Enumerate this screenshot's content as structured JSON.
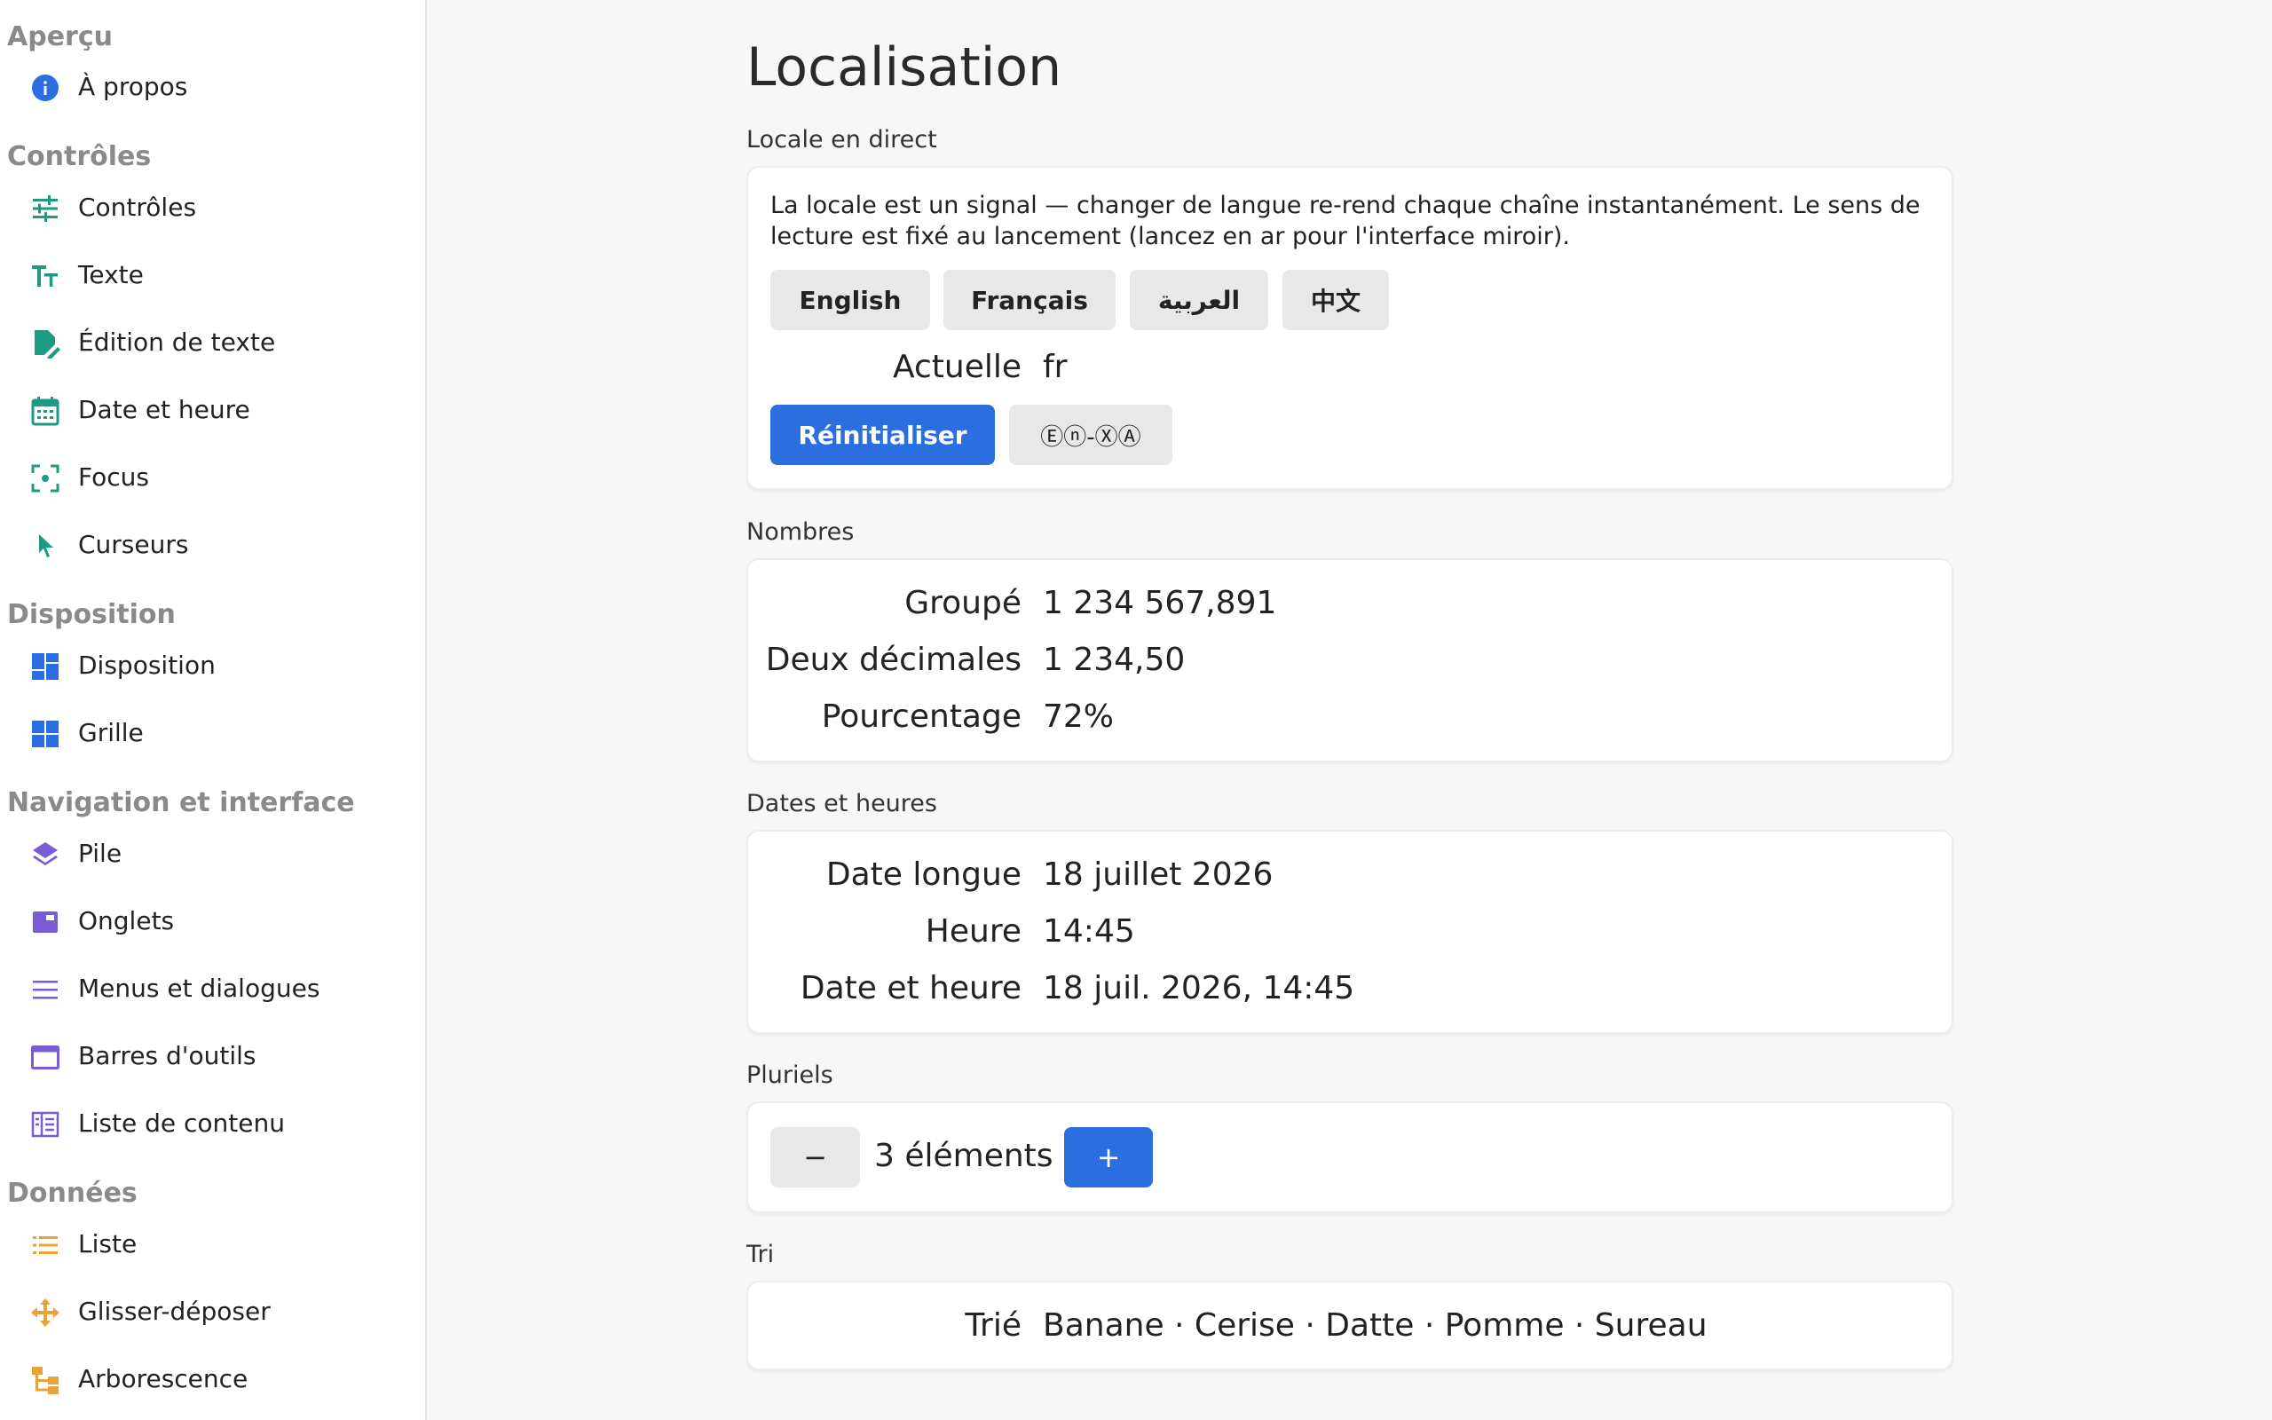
{
  "sidebar": {
    "sections": [
      {
        "title": "Aperçu",
        "items": [
          {
            "label": "À propos",
            "icon": "info-icon"
          }
        ]
      },
      {
        "title": "Contrôles",
        "items": [
          {
            "label": "Contrôles",
            "icon": "sliders-icon"
          },
          {
            "label": "Texte",
            "icon": "text-size-icon"
          },
          {
            "label": "Édition de texte",
            "icon": "edit-document-icon"
          },
          {
            "label": "Date et heure",
            "icon": "calendar-icon"
          },
          {
            "label": "Focus",
            "icon": "focus-icon"
          },
          {
            "label": "Curseurs",
            "icon": "pointer-icon"
          }
        ]
      },
      {
        "title": "Disposition",
        "items": [
          {
            "label": "Disposition",
            "icon": "dashboard-icon"
          },
          {
            "label": "Grille",
            "icon": "grid-icon"
          }
        ]
      },
      {
        "title": "Navigation et interface",
        "items": [
          {
            "label": "Pile",
            "icon": "layers-icon"
          },
          {
            "label": "Onglets",
            "icon": "tabs-icon"
          },
          {
            "label": "Menus et dialogues",
            "icon": "menu-icon"
          },
          {
            "label": "Barres d'outils",
            "icon": "toolbar-icon"
          },
          {
            "label": "Liste de contenu",
            "icon": "content-list-icon"
          }
        ]
      },
      {
        "title": "Données",
        "items": [
          {
            "label": "Liste",
            "icon": "list-icon"
          },
          {
            "label": "Glisser-déposer",
            "icon": "drag-move-icon"
          },
          {
            "label": "Arborescence",
            "icon": "tree-icon"
          }
        ]
      }
    ]
  },
  "colors": {
    "accent_blue": "#2a6ee0",
    "teal_icon": "#1f9a82",
    "blue_icon": "#2a6ee0",
    "purple_icon": "#7a5bd6",
    "orange_icon": "#e8a23a",
    "section_grey": "#8a8a8a"
  },
  "main": {
    "title": "Localisation",
    "live_locale": {
      "label": "Locale en direct",
      "description": "La locale est un signal — changer de langue re-rend chaque chaîne instantanément. Le sens de lecture est fixé au lancement (lancez en ar pour l'interface miroir).",
      "language_buttons": [
        "English",
        "Français",
        "العربية",
        "中文"
      ],
      "current_label": "Actuelle",
      "current_value": "fr",
      "reset_label": "Réinitialiser",
      "pseudo_label": "Ⓔⓝ-ⓍⒶ"
    },
    "numbers": {
      "label": "Nombres",
      "rows": [
        {
          "key": "Groupé",
          "value": "1 234 567,891"
        },
        {
          "key": "Deux décimales",
          "value": "1 234,50"
        },
        {
          "key": "Pourcentage",
          "value": "72%"
        }
      ]
    },
    "dates": {
      "label": "Dates et heures",
      "rows": [
        {
          "key": "Date longue",
          "value": "18 juillet 2026"
        },
        {
          "key": "Heure",
          "value": "14:45"
        },
        {
          "key": "Date et heure",
          "value": "18 juil. 2026, 14:45"
        }
      ]
    },
    "plurals": {
      "label": "Pluriels",
      "minus_label": "−",
      "count_text": "3 éléments",
      "plus_label": "+"
    },
    "sorting": {
      "label": "Tri",
      "key": "Trié",
      "value": "Banane · Cerise · Datte · Pomme · Sureau"
    }
  }
}
